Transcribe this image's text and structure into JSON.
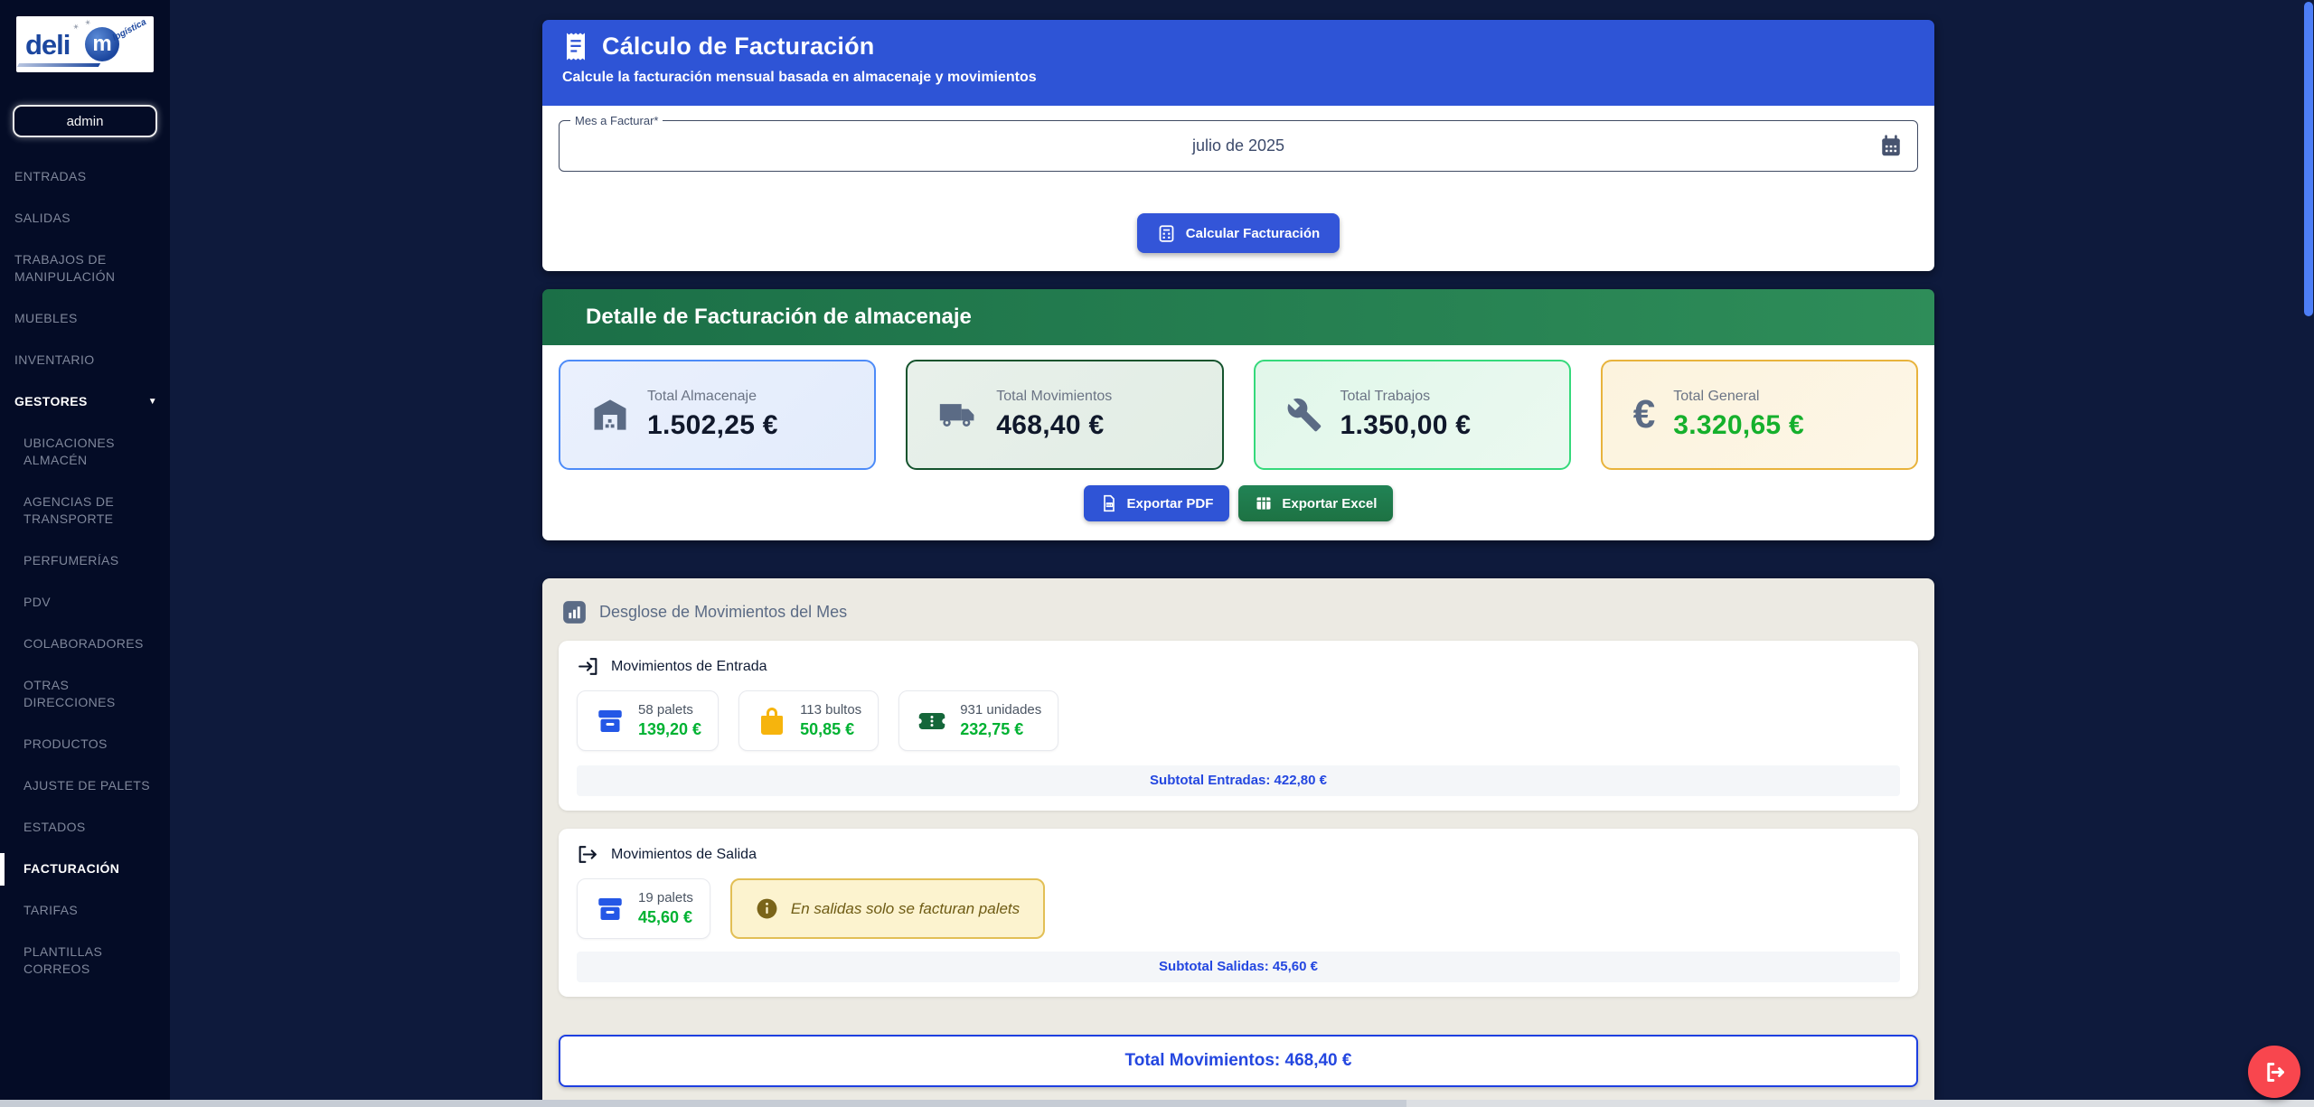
{
  "sidebar": {
    "logo": {
      "brand_prefix": "deli",
      "brand_suffix": "m",
      "tagline": "logística"
    },
    "user": "admin",
    "items": [
      {
        "label": "ENTRADAS"
      },
      {
        "label": "SALIDAS"
      },
      {
        "label": "TRABAJOS DE MANIPULACIÓN"
      },
      {
        "label": "MUEBLES"
      },
      {
        "label": "INVENTARIO"
      },
      {
        "label": "GESTORES"
      }
    ],
    "subitems": [
      {
        "label": "UBICACIONES ALMACÉN"
      },
      {
        "label": "AGENCIAS DE TRANSPORTE"
      },
      {
        "label": "PERFUMERÍAS"
      },
      {
        "label": "PDV"
      },
      {
        "label": "COLABORADORES"
      },
      {
        "label": "OTRAS DIRECCIONES"
      },
      {
        "label": "PRODUCTOS"
      },
      {
        "label": "AJUSTE DE PALETS"
      },
      {
        "label": "ESTADOS"
      },
      {
        "label": "FACTURACIÓN"
      },
      {
        "label": "TARIFAS"
      },
      {
        "label": "PLANTILLAS CORREOS"
      }
    ],
    "active_item": "FACTURACIÓN"
  },
  "header": {
    "title": "Cálculo de Facturación",
    "subtitle": "Calcule la facturación mensual basada en almacenaje y movimientos"
  },
  "form": {
    "month_label": "Mes a Facturar*",
    "month_value": "julio de 2025",
    "calculate_button": "Calcular Facturación"
  },
  "detail": {
    "title": "Detalle de Facturación de almacenaje",
    "cards": [
      {
        "label": "Total Almacenaje",
        "value": "1.502,25 €"
      },
      {
        "label": "Total Movimientos",
        "value": "468,40 €"
      },
      {
        "label": "Total Trabajos",
        "value": "1.350,00 €"
      },
      {
        "label": "Total General",
        "value": "3.320,65 €"
      }
    ],
    "export_pdf": "Exportar PDF",
    "export_excel": "Exportar Excel"
  },
  "breakdown": {
    "title": "Desglose de Movimientos del Mes",
    "entries": {
      "title": "Movimientos de Entrada",
      "items": [
        {
          "qty": "58 palets",
          "value": "139,20 €"
        },
        {
          "qty": "113 bultos",
          "value": "50,85 €"
        },
        {
          "qty": "931 unidades",
          "value": "232,75 €"
        }
      ],
      "subtotal": "Subtotal Entradas: 422,80 €"
    },
    "exits": {
      "title": "Movimientos de Salida",
      "items": [
        {
          "qty": "19 palets",
          "value": "45,60 €"
        }
      ],
      "note": "En salidas solo se facturan palets",
      "subtotal": "Subtotal Salidas: 45,60 €"
    },
    "total": "Total Movimientos: 468,40 €"
  },
  "icons": {
    "chevron_down": "▼",
    "euro": "€",
    "stars": "✶ ✶"
  },
  "colors": {
    "header_blue": "#2e54d6",
    "green_header_start": "#1b6f47",
    "green_header_end": "#2e8d59",
    "value_green": "#15b02c",
    "mini_value_green": "#00b232",
    "link_blue": "#2447e0",
    "logout_red": "#f8464e",
    "sidebar_bg": "#040c26",
    "main_bg": "#0e1a3c"
  }
}
